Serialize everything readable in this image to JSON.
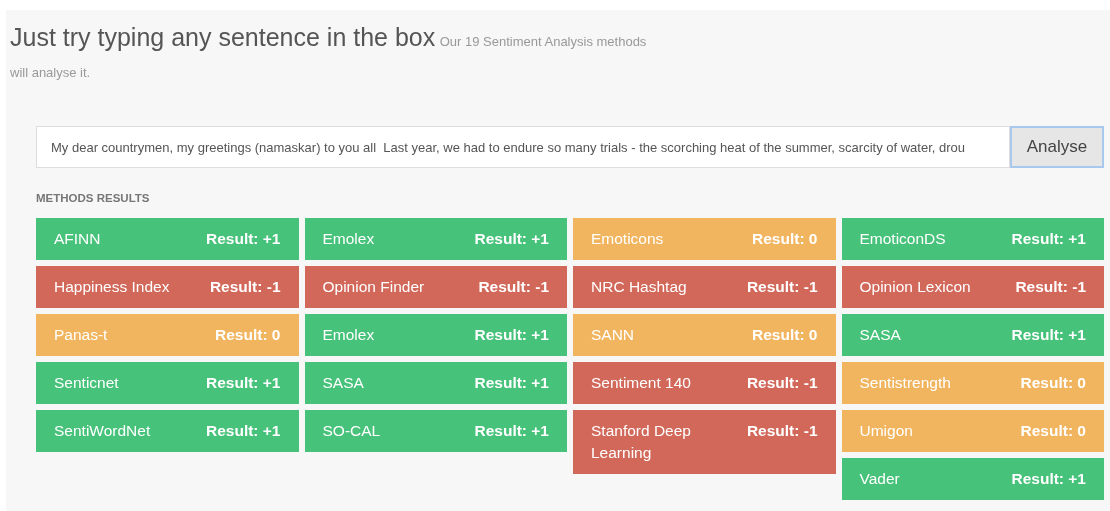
{
  "heading": {
    "title": "Just try typing any sentence in the box",
    "subtitle_lines": [
      "Our 19 Sentiment Analysis methods",
      "will analyse it."
    ]
  },
  "input": {
    "value": "My dear countrymen, my greetings (namaskar) to you all  Last year, we had to endure so many trials - the scorching heat of the summer, scarcity of water, drou"
  },
  "analyse_button": "Analyse",
  "results_label": "METHODS RESULTS",
  "columns": [
    [
      {
        "method": "AFINN",
        "result": "Result: +1",
        "kind": "positive"
      },
      {
        "method": "Happiness Index",
        "result": "Result: -1",
        "kind": "negative"
      },
      {
        "method": "Panas-t",
        "result": "Result: 0",
        "kind": "neutral"
      },
      {
        "method": "Senticnet",
        "result": "Result: +1",
        "kind": "positive"
      },
      {
        "method": "SentiWordNet",
        "result": "Result: +1",
        "kind": "positive"
      }
    ],
    [
      {
        "method": "Emolex",
        "result": "Result: +1",
        "kind": "positive"
      },
      {
        "method": "Opinion Finder",
        "result": "Result: -1",
        "kind": "negative"
      },
      {
        "method": "Emolex",
        "result": "Result: +1",
        "kind": "positive"
      },
      {
        "method": "SASA",
        "result": "Result: +1",
        "kind": "positive"
      },
      {
        "method": "SO-CAL",
        "result": "Result: +1",
        "kind": "positive"
      }
    ],
    [
      {
        "method": "Emoticons",
        "result": "Result: 0",
        "kind": "neutral"
      },
      {
        "method": "NRC Hashtag",
        "result": "Result: -1",
        "kind": "negative"
      },
      {
        "method": "SANN",
        "result": "Result: 0",
        "kind": "neutral"
      },
      {
        "method": "Sentiment 140",
        "result": "Result: -1",
        "kind": "negative"
      },
      {
        "method": "Stanford Deep Learning",
        "result": "Result: -1",
        "kind": "negative"
      }
    ],
    [
      {
        "method": "EmoticonDS",
        "result": "Result: +1",
        "kind": "positive"
      },
      {
        "method": "Opinion Lexicon",
        "result": "Result: -1",
        "kind": "negative"
      },
      {
        "method": "SASA",
        "result": "Result: +1",
        "kind": "positive"
      },
      {
        "method": "Sentistrength",
        "result": "Result: 0",
        "kind": "neutral"
      },
      {
        "method": "Umigon",
        "result": "Result: 0",
        "kind": "neutral"
      },
      {
        "method": "Vader",
        "result": "Result: +1",
        "kind": "positive"
      }
    ]
  ]
}
